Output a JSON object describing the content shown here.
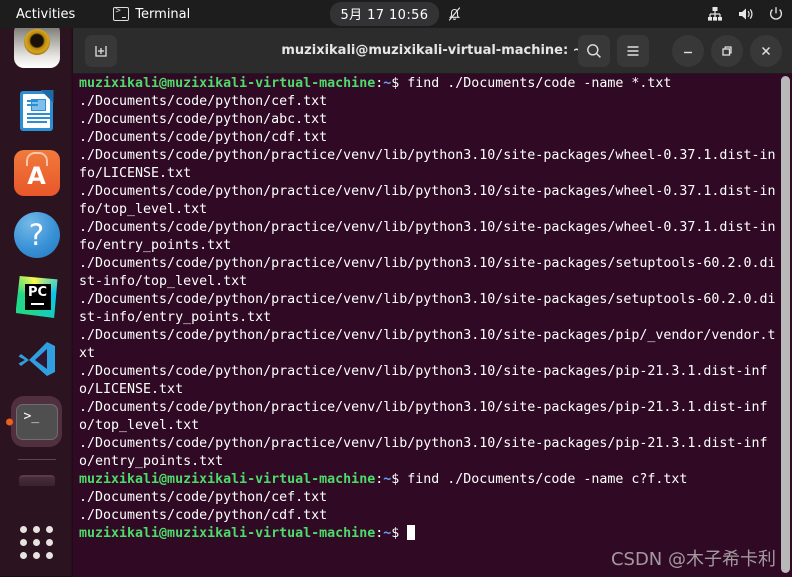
{
  "topbar": {
    "activities": "Activities",
    "app_name": "Terminal",
    "app_icon": "terminal-icon",
    "clock": "5月 17  10:56",
    "notification_icon": "bell-muted-icon",
    "status_icons": [
      "network-icon",
      "volume-icon",
      "power-icon"
    ]
  },
  "dock": {
    "items": [
      {
        "name": "shotwell-photo-viewer",
        "label": "Shotwell"
      },
      {
        "name": "libreoffice-writer",
        "label": "LibreOffice Writer"
      },
      {
        "name": "ubuntu-software",
        "label": "Ubuntu Software"
      },
      {
        "name": "help",
        "label": "Help"
      },
      {
        "name": "pycharm",
        "label": "PyCharm",
        "text": "PC"
      },
      {
        "name": "vscode",
        "label": "Visual Studio Code"
      },
      {
        "name": "terminal",
        "label": "Terminal",
        "running": true
      }
    ],
    "trash_label": "Trash",
    "show_apps_label": "Show Applications"
  },
  "window": {
    "title": "muzixikali@muzixikali-virtual-machine: ~",
    "new_tab_icon": "new-tab-icon",
    "search_icon": "search-icon",
    "menu_icon": "hamburger-menu-icon",
    "minimize_icon": "minimize-icon",
    "maximize_icon": "maximize-icon",
    "close_icon": "close-icon"
  },
  "terminal": {
    "prompt_user": "muzixikali@muzixikali-virtual-machine",
    "prompt_colon": ":",
    "prompt_path": "~",
    "prompt_dollar": "$ ",
    "command_1": "find ./Documents/code -name *.txt",
    "output_1": [
      "./Documents/code/python/cef.txt",
      "./Documents/code/python/abc.txt",
      "./Documents/code/python/cdf.txt",
      "./Documents/code/python/practice/venv/lib/python3.10/site-packages/wheel-0.37.1.dist-info/LICENSE.txt",
      "./Documents/code/python/practice/venv/lib/python3.10/site-packages/wheel-0.37.1.dist-info/top_level.txt",
      "./Documents/code/python/practice/venv/lib/python3.10/site-packages/wheel-0.37.1.dist-info/entry_points.txt",
      "./Documents/code/python/practice/venv/lib/python3.10/site-packages/setuptools-60.2.0.dist-info/top_level.txt",
      "./Documents/code/python/practice/venv/lib/python3.10/site-packages/setuptools-60.2.0.dist-info/entry_points.txt",
      "./Documents/code/python/practice/venv/lib/python3.10/site-packages/pip/_vendor/vendor.txt",
      "./Documents/code/python/practice/venv/lib/python3.10/site-packages/pip-21.3.1.dist-info/LICENSE.txt",
      "./Documents/code/python/practice/venv/lib/python3.10/site-packages/pip-21.3.1.dist-info/top_level.txt",
      "./Documents/code/python/practice/venv/lib/python3.10/site-packages/pip-21.3.1.dist-info/entry_points.txt"
    ],
    "command_2": "find ./Documents/code -name c?f.txt",
    "output_2": [
      "./Documents/code/python/cef.txt",
      "./Documents/code/python/cdf.txt"
    ],
    "watermark": "CSDN @木子希卡利"
  },
  "colors": {
    "terminal_bg": "#300a24",
    "prompt_green": "#4ddb6a",
    "prompt_blue": "#6c9ef8",
    "topbar_bg": "#1d1d1d",
    "titlebar_bg": "#2c2c2c"
  }
}
